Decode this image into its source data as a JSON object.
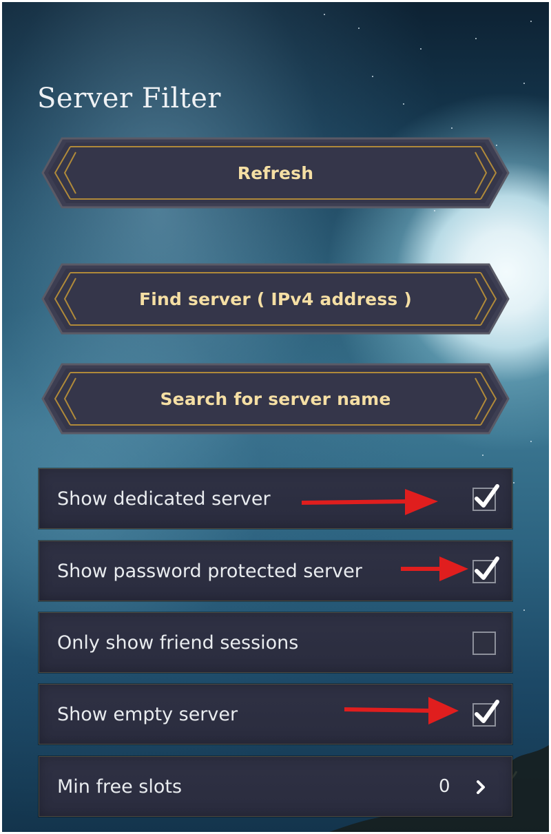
{
  "panel": {
    "title": "Server Filter"
  },
  "buttons": {
    "refresh": "Refresh",
    "find_server": "Find server ( IPv4 address )",
    "search_name": "Search for server name"
  },
  "filters": [
    {
      "label": "Show dedicated server",
      "checked": true
    },
    {
      "label": "Show password protected server",
      "checked": true
    },
    {
      "label": "Only show friend sessions",
      "checked": false
    },
    {
      "label": "Show empty server",
      "checked": true
    }
  ],
  "min_free_slots": {
    "label": "Min free slots",
    "value": "0"
  },
  "colors": {
    "button_text": "#f5dfa4",
    "button_trim": "#b08a3a",
    "annotation_arrow": "#e01e1e"
  },
  "icons": [
    "check-icon",
    "chevron-right-icon",
    "red-arrow-annotation"
  ]
}
